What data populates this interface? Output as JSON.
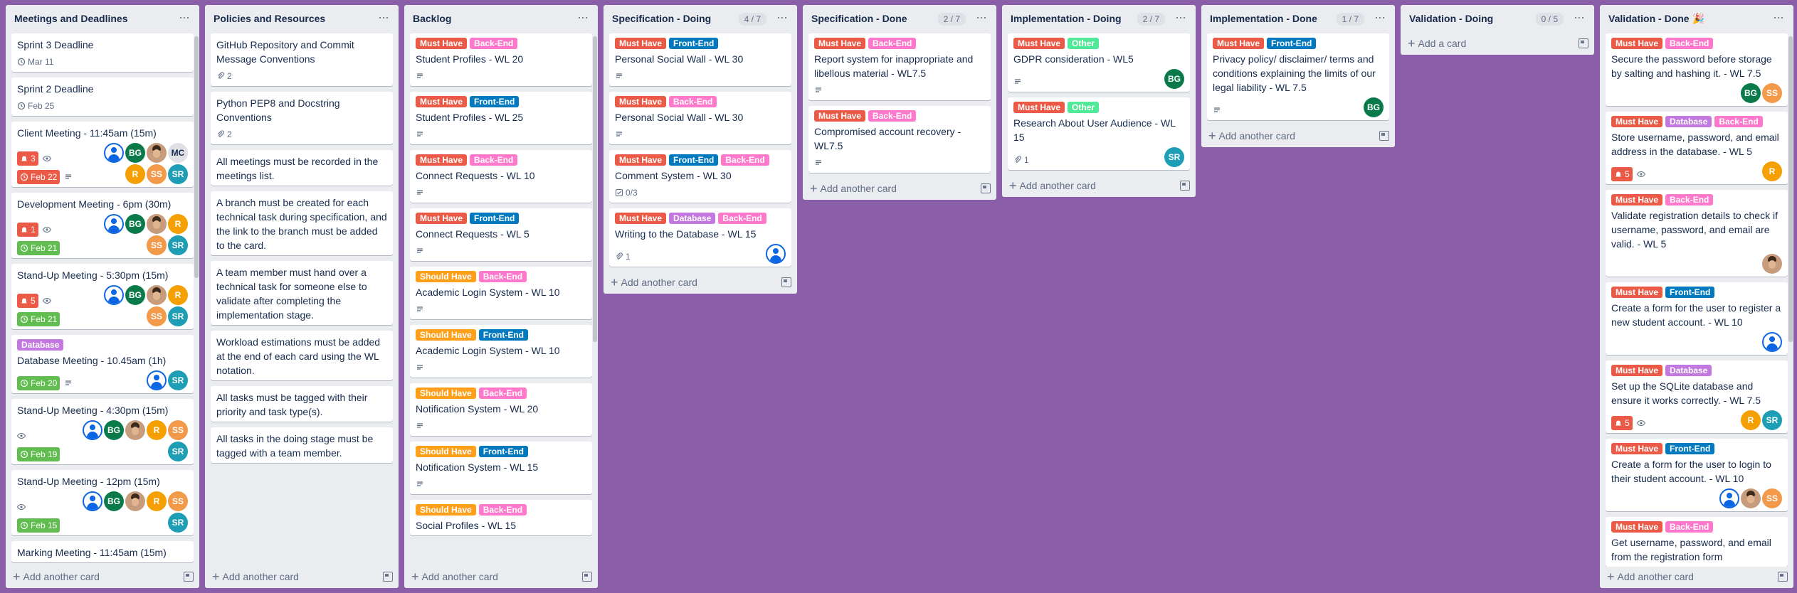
{
  "colors": {
    "board_bg": "#8a5ea8",
    "must_have": "#eb5a46",
    "should_have": "#ff9f1a",
    "back_end": "#ff78cb",
    "front_end": "#0079bf",
    "database": "#c377e0",
    "other": "#51e898"
  },
  "labels": {
    "must": "Must Have",
    "should": "Should Have",
    "back": "Back-End",
    "front": "Front-End",
    "db": "Database",
    "other": "Other"
  },
  "add_card": "Add another card",
  "add_a_card": "Add a card",
  "lists": [
    {
      "title": "Meetings and Deadlines",
      "count": "",
      "cards": [
        {
          "title": "Sprint 3 Deadline",
          "due": "Mar 11"
        },
        {
          "title": "Sprint 2 Deadline",
          "due": "Feb 25"
        },
        {
          "title": "Client Meeting - 11:45am (15m)",
          "notif": "3",
          "watch": true,
          "due_red": "Feb 22",
          "desc": true,
          "members": [
            "person",
            "BG",
            "photo",
            "MC",
            "R",
            "SS",
            "SR"
          ]
        },
        {
          "title": "Development Meeting - 6pm (30m)",
          "notif": "1",
          "watch": true,
          "due_green": "Feb 21",
          "members": [
            "person",
            "BG",
            "photo",
            "R",
            "SS",
            "SR"
          ]
        },
        {
          "title": "Stand-Up Meeting - 5:30pm (15m)",
          "notif": "5",
          "watch": true,
          "due_green": "Feb 21",
          "members": [
            "person",
            "BG",
            "photo",
            "R",
            "SS",
            "SR"
          ]
        },
        {
          "labels": [
            "db"
          ],
          "title": "Database Meeting - 10.45am (1h)",
          "due_green": "Feb 20",
          "desc": true,
          "members": [
            "person",
            "SR"
          ]
        },
        {
          "title": "Stand-Up Meeting - 4:30pm (15m)",
          "watch": true,
          "due_green": "Feb 19",
          "members": [
            "person",
            "BG",
            "photo",
            "R",
            "SS",
            "SR"
          ]
        },
        {
          "title": "Stand-Up Meeting - 12pm (15m)",
          "watch": true,
          "due_green": "Feb 15",
          "members": [
            "person",
            "BG",
            "photo",
            "R",
            "SS",
            "SR"
          ]
        },
        {
          "title": "Marking Meeting - 11:45am (15m)"
        }
      ]
    },
    {
      "title": "Policies and Resources",
      "count": "",
      "cards": [
        {
          "title": "GitHub Repository and Commit Message Conventions",
          "attach": "2"
        },
        {
          "title": "Python PEP8 and Docstring Conventions",
          "attach": "2"
        },
        {
          "title": "All meetings must be recorded in the meetings list."
        },
        {
          "title": "A branch must be created for each technical task during specification, and the link to the branch must be added to the card."
        },
        {
          "title": "A team member must hand over a technical task for someone else to validate after completing the implementation stage."
        },
        {
          "title": "Workload estimations must be added at the end of each card using the WL notation."
        },
        {
          "title": "All tasks must be tagged with their priority and task type(s)."
        },
        {
          "title": "All tasks in the doing stage must be tagged with a team member."
        }
      ]
    },
    {
      "title": "Backlog",
      "count": "",
      "cards": [
        {
          "labels": [
            "must",
            "back"
          ],
          "title": "Student Profiles - WL 20",
          "desc": true
        },
        {
          "labels": [
            "must",
            "front"
          ],
          "title": "Student Profiles - WL 25",
          "desc": true
        },
        {
          "labels": [
            "must",
            "back"
          ],
          "title": "Connect Requests - WL 10",
          "desc": true
        },
        {
          "labels": [
            "must",
            "front"
          ],
          "title": "Connect Requests - WL 5",
          "desc": true
        },
        {
          "labels": [
            "should",
            "back"
          ],
          "title": "Academic Login System - WL 10",
          "desc": true
        },
        {
          "labels": [
            "should",
            "front"
          ],
          "title": "Academic Login System - WL 10",
          "desc": true
        },
        {
          "labels": [
            "should",
            "back"
          ],
          "title": "Notification System - WL 20",
          "desc": true
        },
        {
          "labels": [
            "should",
            "front"
          ],
          "title": "Notification System - WL 15",
          "desc": true
        },
        {
          "labels": [
            "should",
            "back"
          ],
          "title": "Social Profiles - WL 15"
        }
      ]
    },
    {
      "title": "Specification - Doing",
      "count": "4 / 7",
      "cards": [
        {
          "labels": [
            "must",
            "front"
          ],
          "title": "Personal Social Wall - WL 30",
          "desc": true
        },
        {
          "labels": [
            "must",
            "back"
          ],
          "title": "Personal Social Wall - WL 30",
          "desc": true
        },
        {
          "labels": [
            "must",
            "front",
            "back"
          ],
          "title": "Comment System - WL 30",
          "checklist": "0/3"
        },
        {
          "labels": [
            "must",
            "db",
            "back"
          ],
          "title": "Writing to the Database - WL 15",
          "attach": "1",
          "members": [
            "person"
          ]
        }
      ]
    },
    {
      "title": "Specification - Done",
      "count": "2 / 7",
      "cards": [
        {
          "labels": [
            "must",
            "back"
          ],
          "title": "Report system for inappropriate and libellous material - WL7.5",
          "desc": true
        },
        {
          "labels": [
            "must",
            "back"
          ],
          "title": "Compromised account recovery - WL7.5",
          "desc": true
        }
      ]
    },
    {
      "title": "Implementation - Doing",
      "count": "2 / 7",
      "cards": [
        {
          "labels": [
            "must",
            "other"
          ],
          "title": "GDPR consideration - WL5",
          "desc": true,
          "members": [
            "BG"
          ]
        },
        {
          "labels": [
            "must",
            "other"
          ],
          "title": "Research About User Audience - WL 15",
          "attach": "1",
          "members": [
            "SR"
          ]
        }
      ]
    },
    {
      "title": "Implementation - Done",
      "count": "1 / 7",
      "cards": [
        {
          "labels": [
            "must",
            "front"
          ],
          "title": "Privacy policy/ disclaimer/ terms and conditions explaining the limits of our legal liability - WL 7.5",
          "desc": true,
          "members": [
            "BG"
          ]
        }
      ]
    },
    {
      "title": "Validation - Doing",
      "count": "0 / 5",
      "cards": []
    },
    {
      "title": "Validation - Done",
      "count": "",
      "emoji": "🎉",
      "cards": [
        {
          "labels": [
            "must",
            "back"
          ],
          "title": "Secure the password before storage by salting and hashing it. - WL 7.5",
          "members": [
            "BG",
            "SS"
          ]
        },
        {
          "labels": [
            "must",
            "db",
            "back"
          ],
          "title": "Store username, password, and email address in the database. - WL 5",
          "notif": "5",
          "watch": true,
          "members": [
            "R"
          ]
        },
        {
          "labels": [
            "must",
            "back"
          ],
          "title": "Validate registration details to check if username, password, and email are valid. - WL 5",
          "members": [
            "photo"
          ]
        },
        {
          "labels": [
            "must",
            "front"
          ],
          "title": "Create a form for the user to register a new student account. - WL 10",
          "members": [
            "person"
          ]
        },
        {
          "labels": [
            "must",
            "db"
          ],
          "title": "Set up the SQLite database and ensure it works correctly. - WL 7.5",
          "notif": "5",
          "watch": true,
          "members": [
            "R",
            "SR"
          ]
        },
        {
          "labels": [
            "must",
            "front"
          ],
          "title": "Create a form for the user to login to their student account. - WL 10",
          "members": [
            "person",
            "photo",
            "SS"
          ]
        },
        {
          "labels": [
            "must",
            "back"
          ],
          "title": "Get username, password, and email from the registration form"
        }
      ]
    }
  ]
}
